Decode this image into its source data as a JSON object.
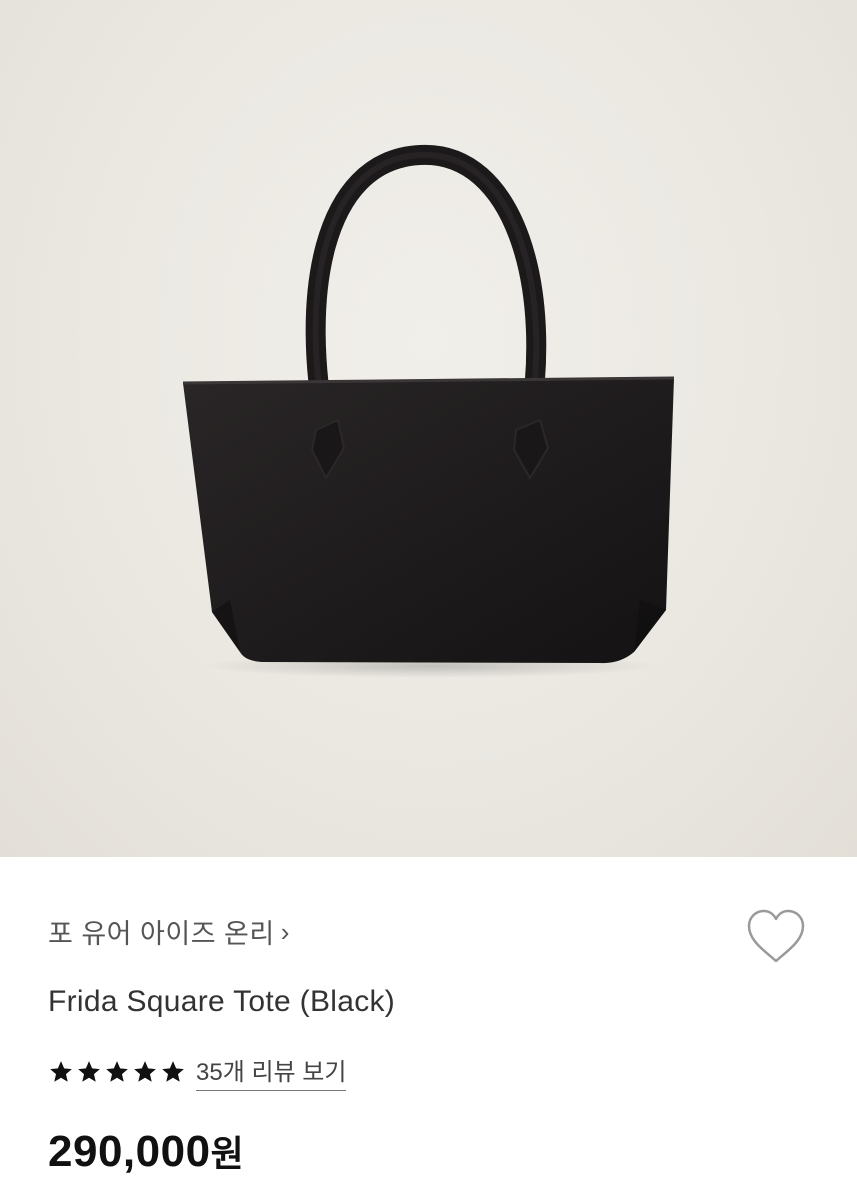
{
  "product": {
    "brand": "포 유어 아이즈 온리",
    "brand_chevron": "›",
    "name": "Frida Square Tote (Black)",
    "rating": 5,
    "rating_max": 5,
    "review_link": "35개 리뷰 보기",
    "price": "290,000",
    "price_unit": "원"
  },
  "icons": {
    "wishlist": "heart-outline-icon",
    "star": "star-filled-icon"
  },
  "colors": {
    "hero_background": "#ebe8e2",
    "bag": "#1e1b1c",
    "text": "#222222"
  }
}
